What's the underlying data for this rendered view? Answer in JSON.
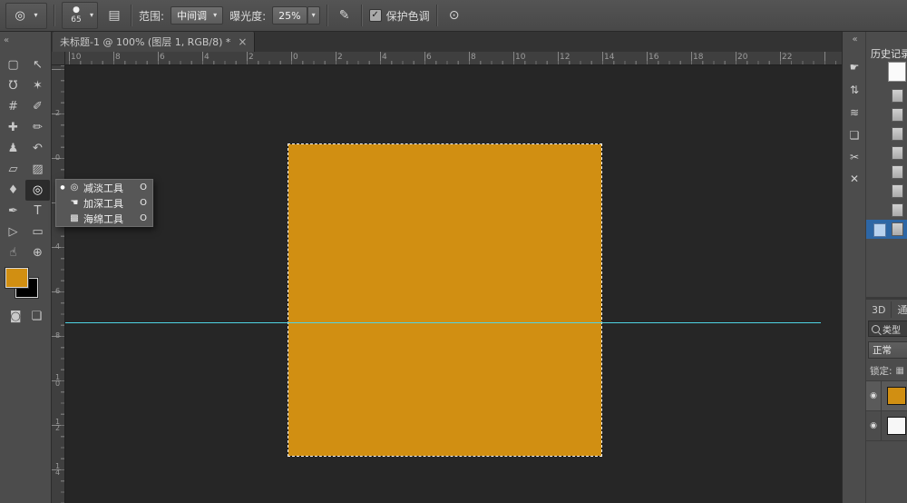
{
  "options_bar": {
    "tool_glyph": "◎",
    "dropdown_glyph": "▾",
    "brush_dot_glyph": "●",
    "brush_size": "65",
    "panel_glyph": "▤",
    "range_label": "范围:",
    "range_value": "中间调",
    "exposure_label": "曝光度:",
    "exposure_value": "25%",
    "airbrush_glyph": "✎",
    "protect_label": "保护色调",
    "protect_checked": true,
    "check_glyph": "✓",
    "pressure_glyph": "⊙"
  },
  "tools_header": {
    "collapse_glyph": "«"
  },
  "tab": {
    "title": "未标题-1 @ 100% (图层 1, RGB/8) *",
    "close_glyph": "×"
  },
  "toolbar": {
    "tools": [
      {
        "name": "rectangular-marquee-tool",
        "glyph": "▢"
      },
      {
        "name": "move-tool",
        "glyph": "↖"
      },
      {
        "name": "lasso-tool",
        "glyph": "℧"
      },
      {
        "name": "magic-wand-tool",
        "glyph": "✶"
      },
      {
        "name": "crop-tool",
        "glyph": "#"
      },
      {
        "name": "eyedropper-tool",
        "glyph": "✐"
      },
      {
        "name": "healing-brush-tool",
        "glyph": "✚"
      },
      {
        "name": "brush-tool",
        "glyph": "✏"
      },
      {
        "name": "clone-stamp-tool",
        "glyph": "♟"
      },
      {
        "name": "history-brush-tool",
        "glyph": "↶"
      },
      {
        "name": "eraser-tool",
        "glyph": "▱"
      },
      {
        "name": "gradient-tool",
        "glyph": "▨"
      },
      {
        "name": "blur-tool",
        "glyph": "♦"
      },
      {
        "name": "dodge-tool",
        "glyph": "◎",
        "selected": true
      },
      {
        "name": "pen-tool",
        "glyph": "✒"
      },
      {
        "name": "type-tool",
        "glyph": "T"
      },
      {
        "name": "path-selection-tool",
        "glyph": "▷"
      },
      {
        "name": "shape-tool",
        "glyph": "▭"
      },
      {
        "name": "hand-tool",
        "glyph": "☝"
      },
      {
        "name": "zoom-tool",
        "glyph": "⊕"
      }
    ],
    "foreground_color": "#d18f12",
    "background_color": "#000000",
    "quick_mask_glyph": "◙",
    "screen_mode_glyph": "❏"
  },
  "flyout": {
    "items": [
      {
        "bullet": "●",
        "glyph": "◎",
        "label": "减淡工具",
        "shortcut": "O",
        "selected": true
      },
      {
        "bullet": "",
        "glyph": "☚",
        "label": "加深工具",
        "shortcut": "O",
        "selected": false
      },
      {
        "bullet": "",
        "glyph": "▩",
        "label": "海绵工具",
        "shortcut": "O",
        "selected": false
      }
    ]
  },
  "canvas": {
    "ruler_h": [
      "10",
      "8",
      "6",
      "4",
      "2",
      "0",
      "2",
      "4",
      "6",
      "8",
      "10",
      "12",
      "14",
      "16",
      "18",
      "20",
      "22"
    ],
    "ruler_v": [
      "2",
      "0",
      "2",
      "4",
      "6",
      "8",
      "10",
      "12",
      "14"
    ],
    "square_color": "#d18f12",
    "guide_color": "#4fd4e4",
    "selection_visible": true
  },
  "dock": {
    "collapse_glyph": "«",
    "icons": [
      {
        "name": "hand-panel-icon",
        "glyph": "☛"
      },
      {
        "name": "arrows-panel-icon",
        "glyph": "⇅"
      },
      {
        "name": "waves-panel-icon",
        "glyph": "≋"
      },
      {
        "name": "layers-panel-icon",
        "glyph": "❏"
      },
      {
        "name": "scissors-panel-icon",
        "glyph": "✂"
      },
      {
        "name": "close-panel-icon",
        "glyph": "✕"
      }
    ]
  },
  "right_panel": {
    "history_title": "历史记录",
    "history_selected_color": "#2d66a5",
    "tab_3d": "3D",
    "tab_channels": "通道",
    "filter_label": "类型",
    "blend_mode": "正常",
    "lock_label": "锁定:",
    "lock_glyph": "▦",
    "eye_glyph": "◉"
  }
}
